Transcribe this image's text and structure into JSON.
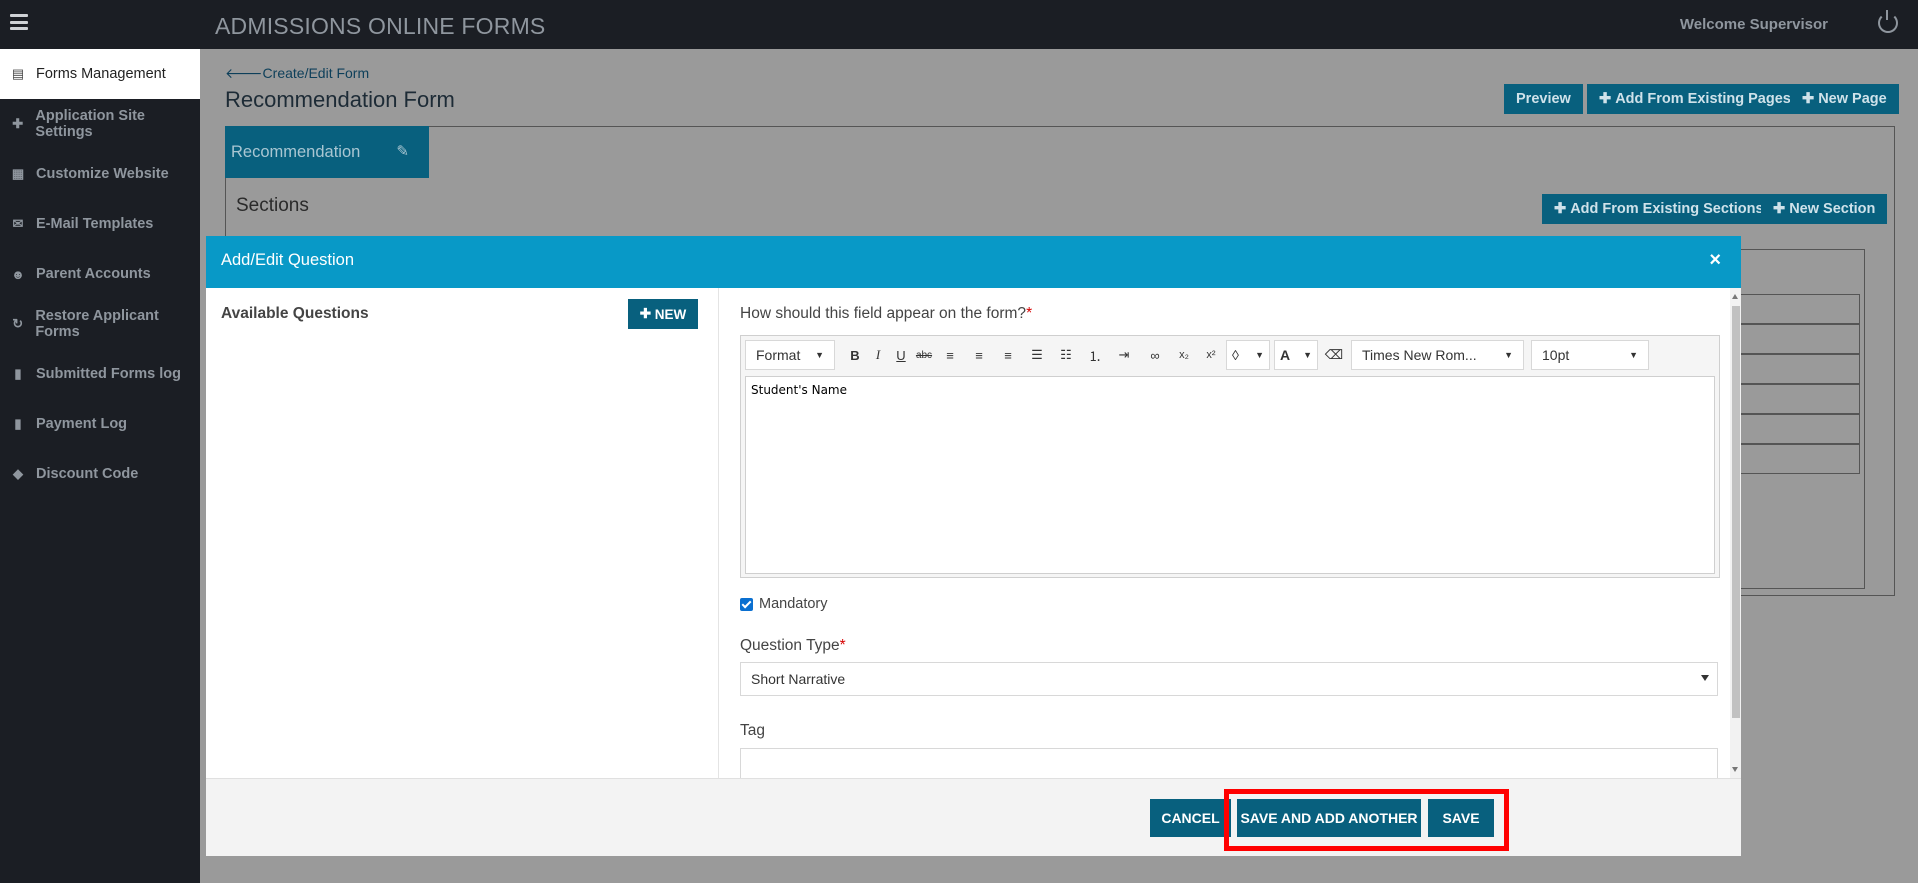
{
  "header": {
    "app_title": "ADMISSIONS ONLINE FORMS",
    "welcome": "Welcome Supervisor"
  },
  "sidebar": {
    "items": [
      {
        "label": "Forms Management",
        "icon": "calendar-icon",
        "active": true
      },
      {
        "label": "Application Site Settings",
        "icon": "plus-icon"
      },
      {
        "label": "Customize Website",
        "icon": "grid-icon"
      },
      {
        "label": "E-Mail Templates",
        "icon": "envelope-icon"
      },
      {
        "label": "Parent Accounts",
        "icon": "users-icon"
      },
      {
        "label": "Restore Applicant Forms",
        "icon": "refresh-icon"
      },
      {
        "label": "Submitted Forms log",
        "icon": "file-icon"
      },
      {
        "label": "Payment Log",
        "icon": "file-icon"
      },
      {
        "label": "Discount Code",
        "icon": "tag-icon"
      }
    ]
  },
  "page": {
    "breadcrumb": "Create/Edit Form",
    "title": "Recommendation Form",
    "preview_label": "Preview",
    "add_existing_pages_label": "Add From Existing Pages",
    "new_page_label": "New Page",
    "tab_label": "Recommendation",
    "sections_label": "Sections",
    "add_existing_sections_label": "Add From Existing Sections",
    "new_section_label": "New Section"
  },
  "modal": {
    "title": "Add/Edit Question",
    "close": "×",
    "available_questions_label": "Available Questions",
    "new_button_label": "NEW",
    "field_label": "How should this field appear on the form?",
    "required_mark": "*",
    "editor": {
      "format_label": "Format",
      "font_name": "Times New Rom...",
      "font_size": "10pt",
      "content": "Student's Name"
    },
    "mandatory_label": "Mandatory",
    "mandatory_checked": true,
    "question_type_label": "Question Type",
    "question_type_value": "Short Narrative",
    "tag_label": "Tag",
    "tag_value": "",
    "buttons": {
      "cancel": "CANCEL",
      "save_and_add": "SAVE AND ADD ANOTHER",
      "save": "SAVE"
    }
  },
  "colors": {
    "sidebar_bg": "#1b1e24",
    "primary_button": "#08607e",
    "modal_header": "#0899c7",
    "highlight": "#ff0000"
  }
}
